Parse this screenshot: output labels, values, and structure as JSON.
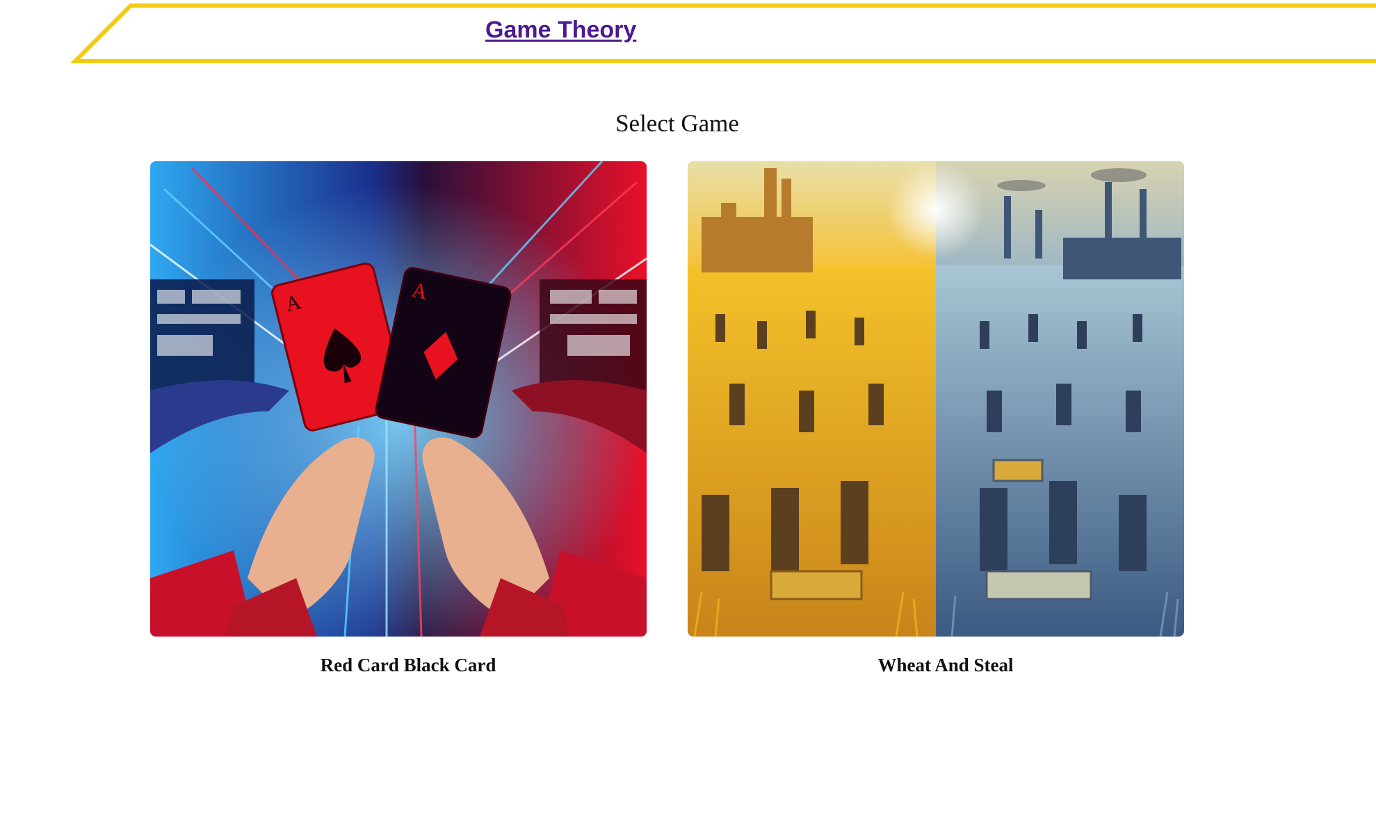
{
  "header": {
    "brand_title": "Game Theory",
    "accent_color": "#f2cc12"
  },
  "main": {
    "title": "Select Game",
    "games": [
      {
        "label": "Red Card Black Card",
        "image": "red-card-black-card-illustration"
      },
      {
        "label": "Wheat And Steal",
        "image": "wheat-and-steal-illustration"
      }
    ]
  }
}
